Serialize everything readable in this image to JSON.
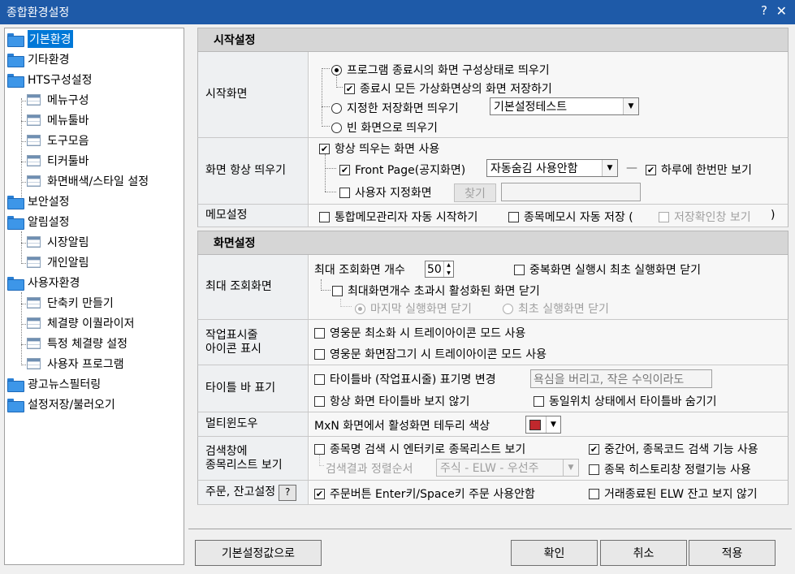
{
  "window": {
    "title": "종합환경설정",
    "help_label": "?",
    "close_label": "✕"
  },
  "tree": {
    "items": [
      {
        "label": "기본환경",
        "icon": "folder-icon"
      },
      {
        "label": "기타환경",
        "icon": "folder-icon"
      },
      {
        "label": "HTS구성설정",
        "icon": "folder-icon"
      },
      {
        "label": "메뉴구성",
        "icon": "page-icon"
      },
      {
        "label": "메뉴툴바",
        "icon": "page-icon"
      },
      {
        "label": "도구모음",
        "icon": "page-icon"
      },
      {
        "label": "티커툴바",
        "icon": "page-icon"
      },
      {
        "label": "화면배색/스타일 설정",
        "icon": "page-icon"
      },
      {
        "label": "보안설정",
        "icon": "folder-icon"
      },
      {
        "label": "알림설정",
        "icon": "folder-icon"
      },
      {
        "label": "시장알림",
        "icon": "page-icon"
      },
      {
        "label": "개인알림",
        "icon": "page-icon"
      },
      {
        "label": "사용자환경",
        "icon": "folder-icon"
      },
      {
        "label": "단축키 만들기",
        "icon": "page-icon"
      },
      {
        "label": "체결량 이퀄라이저",
        "icon": "page-icon"
      },
      {
        "label": "특정 체결량 설정",
        "icon": "page-icon"
      },
      {
        "label": "사용자 프로그램",
        "icon": "page-icon"
      },
      {
        "label": "광고뉴스필터링",
        "icon": "folder-icon"
      },
      {
        "label": "설정저장/불러오기",
        "icon": "folder-icon"
      }
    ],
    "selected": "기본환경"
  },
  "startup": {
    "header": "시작설정",
    "start_screen": {
      "label": "시작화면",
      "opt_restore": "프로그램 종료시의 화면 구성상태로 띄우기",
      "opt_save_all": "종료시 모든 가상화면상의 화면 저장하기",
      "opt_saved": "지정한 저장화면 띄우기",
      "saved_select_value": "기본설정테스트",
      "opt_blank": "빈 화면으로 띄우기"
    },
    "always_screen": {
      "label": "화면 항상 띄우기",
      "always_use": "항상 띄우는 화면 사용",
      "front_page": "Front Page(공지화면)",
      "front_select_value": "자동숨김 사용안함",
      "dash": "—",
      "once_a_day": "하루에 한번만 보기",
      "user_screen": "사용자 지정화면",
      "find_button": "찾기",
      "user_screen_value": ""
    },
    "memo": {
      "label": "메모설정",
      "integrated_memo": "통합메모관리자 자동 시작하기",
      "stock_memo": "종목메모시 자동 저장 (",
      "save_confirm": "저장확인창 보기",
      "close_paren": ")"
    }
  },
  "screen": {
    "header": "화면설정",
    "max_views": {
      "label": "최대 조회화면",
      "count_label": "최대 조회화면 개수",
      "count_value": "50",
      "dup_close": "중복화면 실행시 최초 실행화면 닫기",
      "exceed_close": "최대화면개수 초과시 활성화된 화면 닫기",
      "last_close": "마지막 실행화면 닫기",
      "first_close": "최초 실행화면 닫기"
    },
    "tray": {
      "label_line1": "작업표시줄",
      "label_line2": "아이콘 표시",
      "minimize_tray": "영웅문 최소화 시 트레이아이콘 모드 사용",
      "lock_tray": "영웅문 화면잠그기 시 트레이아이콘 모드 사용"
    },
    "titlebar": {
      "label": "타이틀 바 표기",
      "change_name": "타이틀바 (작업표시줄) 표기명 변경",
      "title_text": "욕심을 버리고, 작은 수익이라도",
      "hide_always": "항상 화면 타이틀바 보지 않기",
      "hide_same": "동일위치 상태에서 타이틀바 숨기기"
    },
    "multiwindow": {
      "label": "멀티윈도우",
      "border_color_label": "MxN 화면에서 활성화면 테두리 색상",
      "border_color": "#c0282d"
    },
    "search": {
      "label_line1": "검색창에",
      "label_line2": "종목리스트 보기",
      "enter_list": "종목명 검색 시 엔터키로 종목리스트 보기",
      "middle_code": "중간어, 종목코드 검색 기능 사용",
      "sort_label": "검색결과 정렬순서",
      "sort_value": "주식 - ELW - 우선주",
      "history_sort": "종목 히스토리창 정렬기능 사용"
    },
    "order": {
      "label": "주문, 잔고설정",
      "help": "?",
      "enter_space": "주문버튼 Enter키/Space키 주문 사용안함",
      "hide_elw": "거래종료된 ELW 잔고 보지 않기"
    }
  },
  "buttons": {
    "defaults": "기본설정값으로",
    "ok": "확인",
    "cancel": "취소",
    "apply": "적용"
  }
}
